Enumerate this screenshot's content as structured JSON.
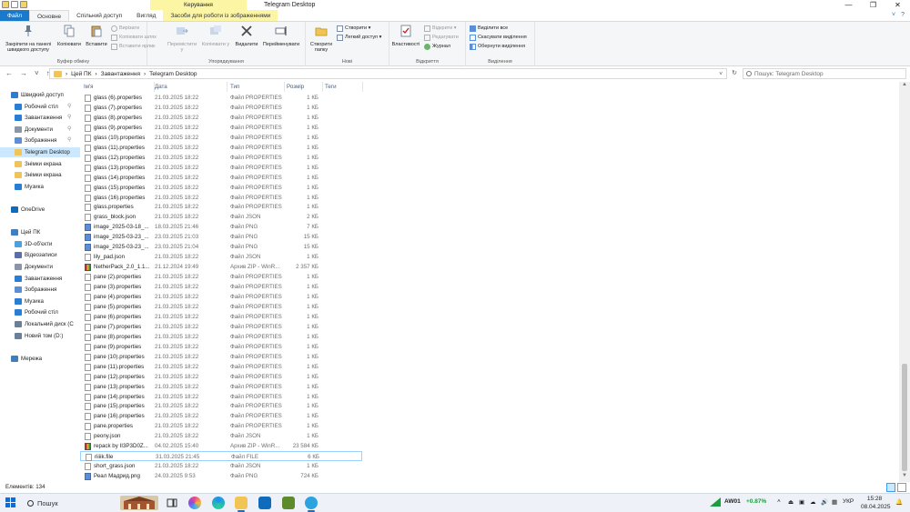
{
  "window": {
    "title": "Telegram Desktop",
    "context_tab_group": "Керування",
    "controls": {
      "minimize": "—",
      "maximize": "❐",
      "close": "✕"
    }
  },
  "ribbon_tabs": [
    {
      "label": "Файл",
      "kind": "file"
    },
    {
      "label": "Основне",
      "kind": "active"
    },
    {
      "label": "Спільний доступ",
      "kind": "normal"
    },
    {
      "label": "Вигляд",
      "kind": "normal"
    },
    {
      "label": "Засоби для роботи із зображеннями",
      "kind": "ctx"
    }
  ],
  "ribbon_right": {
    "collapse": "˅",
    "help": "?"
  },
  "ribbon": {
    "clipboard": {
      "label": "Буфер обміну",
      "pin": "Закріпити на панелі швидкого доступу",
      "copy": "Копіювати",
      "paste": "Вставити",
      "cut": "Вирізати",
      "copy_path": "Копіювати шлях",
      "paste_shortcut": "Вставити ярлик"
    },
    "organize": {
      "label": "Упорядкування",
      "move_to": "Перемістити у",
      "copy_to": "Копіювати у",
      "delete": "Видалити",
      "rename": "Перейменувати"
    },
    "new": {
      "label": "Нові",
      "new_folder": "Створити папку",
      "new_item": "Створити ▾",
      "easy_access": "Легкий доступ ▾"
    },
    "open": {
      "label": "Відкриття",
      "properties": "Властивості",
      "open": "Відкрити ▾",
      "edit": "Редагувати",
      "history": "Журнал"
    },
    "select": {
      "label": "Виділення",
      "select_all": "Виділити все",
      "select_none": "Скасувати виділення",
      "invert": "Обернути виділення"
    }
  },
  "address": {
    "back": "←",
    "forward": "→",
    "recent": "˅",
    "up": "↑",
    "crumbs": [
      "Цей ПК",
      "Завантаження",
      "Telegram Desktop"
    ],
    "sep": "›",
    "dropdown": "˅",
    "refresh": "↻",
    "search_placeholder": "Пошук: Telegram Desktop"
  },
  "nav": [
    {
      "label": "Швидкий доступ",
      "indent": 0,
      "color": "#2b7cd3",
      "pin": false
    },
    {
      "label": "Робочий стіл",
      "indent": 1,
      "color": "#2b7cd3",
      "pin": true
    },
    {
      "label": "Завантаження",
      "indent": 1,
      "color": "#2b7cd3",
      "pin": true
    },
    {
      "label": "Документи",
      "indent": 1,
      "color": "#8a96a8",
      "pin": true
    },
    {
      "label": "Зображення",
      "indent": 1,
      "color": "#5a8fd6",
      "pin": true
    },
    {
      "label": "Telegram Desktop",
      "indent": 1,
      "color": "#f1c555",
      "pin": false,
      "selected": true
    },
    {
      "label": "Знімки екрана",
      "indent": 1,
      "color": "#f1c555",
      "pin": false
    },
    {
      "label": "Знімки екрана",
      "indent": 1,
      "color": "#f1c555",
      "pin": false
    },
    {
      "label": "Музика",
      "indent": 1,
      "color": "#2b7cd3",
      "pin": false
    },
    {
      "label": "",
      "indent": 0,
      "color": "",
      "pin": false
    },
    {
      "label": "OneDrive",
      "indent": 0,
      "color": "#0f6cbd",
      "pin": false
    },
    {
      "label": "",
      "indent": 0,
      "color": "",
      "pin": false
    },
    {
      "label": "Цей ПК",
      "indent": 0,
      "color": "#3f7fbf",
      "pin": false
    },
    {
      "label": "3D-об'єкти",
      "indent": 1,
      "color": "#4aa3df",
      "pin": false
    },
    {
      "label": "Відеозаписи",
      "indent": 1,
      "color": "#5a6ea8",
      "pin": false
    },
    {
      "label": "Документи",
      "indent": 1,
      "color": "#8a96a8",
      "pin": false
    },
    {
      "label": "Завантаження",
      "indent": 1,
      "color": "#2b7cd3",
      "pin": false
    },
    {
      "label": "Зображення",
      "indent": 1,
      "color": "#5a8fd6",
      "pin": false
    },
    {
      "label": "Музика",
      "indent": 1,
      "color": "#2b7cd3",
      "pin": false
    },
    {
      "label": "Робочий стіл",
      "indent": 1,
      "color": "#2b7cd3",
      "pin": false
    },
    {
      "label": "Локальний диск (C",
      "indent": 1,
      "color": "#6b7f99",
      "pin": false
    },
    {
      "label": "Новий том (D:)",
      "indent": 1,
      "color": "#6b7f99",
      "pin": false
    },
    {
      "label": "",
      "indent": 0,
      "color": "",
      "pin": false
    },
    {
      "label": "Мережа",
      "indent": 0,
      "color": "#3f7fbf",
      "pin": false
    }
  ],
  "pin_glyph": "📌",
  "columns": {
    "name": "Ім'я",
    "date": "Дата",
    "type": "Тип",
    "size": "Розмір",
    "tags": "Теги"
  },
  "files": [
    {
      "name": "glass (6).properties",
      "date": "21.03.2025 18:22",
      "type": "Файл PROPERTIES",
      "size": "1 КБ",
      "icon": "doc"
    },
    {
      "name": "glass (7).properties",
      "date": "21.03.2025 18:22",
      "type": "Файл PROPERTIES",
      "size": "1 КБ",
      "icon": "doc"
    },
    {
      "name": "glass (8).properties",
      "date": "21.03.2025 18:22",
      "type": "Файл PROPERTIES",
      "size": "1 КБ",
      "icon": "doc"
    },
    {
      "name": "glass (9).properties",
      "date": "21.03.2025 18:22",
      "type": "Файл PROPERTIES",
      "size": "1 КБ",
      "icon": "doc"
    },
    {
      "name": "glass (10).properties",
      "date": "21.03.2025 18:22",
      "type": "Файл PROPERTIES",
      "size": "1 КБ",
      "icon": "doc"
    },
    {
      "name": "glass (11).properties",
      "date": "21.03.2025 18:22",
      "type": "Файл PROPERTIES",
      "size": "1 КБ",
      "icon": "doc"
    },
    {
      "name": "glass (12).properties",
      "date": "21.03.2025 18:22",
      "type": "Файл PROPERTIES",
      "size": "1 КБ",
      "icon": "doc"
    },
    {
      "name": "glass (13).properties",
      "date": "21.03.2025 18:22",
      "type": "Файл PROPERTIES",
      "size": "1 КБ",
      "icon": "doc"
    },
    {
      "name": "glass (14).properties",
      "date": "21.03.2025 18:22",
      "type": "Файл PROPERTIES",
      "size": "1 КБ",
      "icon": "doc"
    },
    {
      "name": "glass (15).properties",
      "date": "21.03.2025 18:22",
      "type": "Файл PROPERTIES",
      "size": "1 КБ",
      "icon": "doc"
    },
    {
      "name": "glass (16).properties",
      "date": "21.03.2025 18:22",
      "type": "Файл PROPERTIES",
      "size": "1 КБ",
      "icon": "doc"
    },
    {
      "name": "glass.properties",
      "date": "21.03.2025 18:22",
      "type": "Файл PROPERTIES",
      "size": "1 КБ",
      "icon": "doc"
    },
    {
      "name": "grass_block.json",
      "date": "21.03.2025 18:22",
      "type": "Файл JSON",
      "size": "2 КБ",
      "icon": "doc"
    },
    {
      "name": "image_2025-03-18_...",
      "date": "18.03.2025 21:46",
      "type": "Файл PNG",
      "size": "7 КБ",
      "icon": "img"
    },
    {
      "name": "image_2025-03-23_...",
      "date": "23.03.2025 21:03",
      "type": "Файл PNG",
      "size": "15 КБ",
      "icon": "img"
    },
    {
      "name": "image_2025-03-23_...",
      "date": "23.03.2025 21:04",
      "type": "Файл PNG",
      "size": "15 КБ",
      "icon": "img"
    },
    {
      "name": "lily_pad.json",
      "date": "21.03.2025 18:22",
      "type": "Файл JSON",
      "size": "1 КБ",
      "icon": "doc"
    },
    {
      "name": "NetherPack_2.0_1.1...",
      "date": "21.12.2024 19:49",
      "type": "Архив ZIP - WinR...",
      "size": "2 357 КБ",
      "icon": "zip"
    },
    {
      "name": "pane (2).properties",
      "date": "21.03.2025 18:22",
      "type": "Файл PROPERTIES",
      "size": "1 КБ",
      "icon": "doc"
    },
    {
      "name": "pane (3).properties",
      "date": "21.03.2025 18:22",
      "type": "Файл PROPERTIES",
      "size": "1 КБ",
      "icon": "doc"
    },
    {
      "name": "pane (4).properties",
      "date": "21.03.2025 18:22",
      "type": "Файл PROPERTIES",
      "size": "1 КБ",
      "icon": "doc"
    },
    {
      "name": "pane (5).properties",
      "date": "21.03.2025 18:22",
      "type": "Файл PROPERTIES",
      "size": "1 КБ",
      "icon": "doc"
    },
    {
      "name": "pane (6).properties",
      "date": "21.03.2025 18:22",
      "type": "Файл PROPERTIES",
      "size": "1 КБ",
      "icon": "doc"
    },
    {
      "name": "pane (7).properties",
      "date": "21.03.2025 18:22",
      "type": "Файл PROPERTIES",
      "size": "1 КБ",
      "icon": "doc"
    },
    {
      "name": "pane (8).properties",
      "date": "21.03.2025 18:22",
      "type": "Файл PROPERTIES",
      "size": "1 КБ",
      "icon": "doc"
    },
    {
      "name": "pane (9).properties",
      "date": "21.03.2025 18:22",
      "type": "Файл PROPERTIES",
      "size": "1 КБ",
      "icon": "doc"
    },
    {
      "name": "pane (10).properties",
      "date": "21.03.2025 18:22",
      "type": "Файл PROPERTIES",
      "size": "1 КБ",
      "icon": "doc"
    },
    {
      "name": "pane (11).properties",
      "date": "21.03.2025 18:22",
      "type": "Файл PROPERTIES",
      "size": "1 КБ",
      "icon": "doc"
    },
    {
      "name": "pane (12).properties",
      "date": "21.03.2025 18:22",
      "type": "Файл PROPERTIES",
      "size": "1 КБ",
      "icon": "doc"
    },
    {
      "name": "pane (13).properties",
      "date": "21.03.2025 18:22",
      "type": "Файл PROPERTIES",
      "size": "1 КБ",
      "icon": "doc"
    },
    {
      "name": "pane (14).properties",
      "date": "21.03.2025 18:22",
      "type": "Файл PROPERTIES",
      "size": "1 КБ",
      "icon": "doc"
    },
    {
      "name": "pane (15).properties",
      "date": "21.03.2025 18:22",
      "type": "Файл PROPERTIES",
      "size": "1 КБ",
      "icon": "doc"
    },
    {
      "name": "pane (16).properties",
      "date": "21.03.2025 18:22",
      "type": "Файл PROPERTIES",
      "size": "1 КБ",
      "icon": "doc"
    },
    {
      "name": "pane.properties",
      "date": "21.03.2025 18:22",
      "type": "Файл PROPERTIES",
      "size": "1 КБ",
      "icon": "doc"
    },
    {
      "name": "peony.json",
      "date": "21.03.2025 18:22",
      "type": "Файл JSON",
      "size": "1 КБ",
      "icon": "doc"
    },
    {
      "name": "repack by II3P3D0Z...",
      "date": "04.02.2025 15:40",
      "type": "Архив ZIP - WinR...",
      "size": "23 584 КБ",
      "icon": "zip"
    },
    {
      "name": "riiiik.file",
      "date": "31.03.2025 21:45",
      "type": "Файл FILE",
      "size": "6 КБ",
      "icon": "doc",
      "focus": true
    },
    {
      "name": "short_grass.json",
      "date": "21.03.2025 18:22",
      "type": "Файл JSON",
      "size": "1 КБ",
      "icon": "doc"
    },
    {
      "name": "Реал Мадрид.png",
      "date": "24.03.2025 9:53",
      "type": "Файл PNG",
      "size": "724 КБ",
      "icon": "img"
    }
  ],
  "status": {
    "count": "Елементів: 134"
  },
  "taskbar": {
    "search_label": "Пошук",
    "tray": {
      "ticker": "AW01",
      "change": "+0.87%",
      "chevron": "˄",
      "lang": "УКР",
      "time": "15:28",
      "date": "08.04.2025"
    }
  },
  "colors": {
    "accent": "#1979ca",
    "selection": "#cce8ff",
    "ticker_up": "#1a9e3f"
  }
}
